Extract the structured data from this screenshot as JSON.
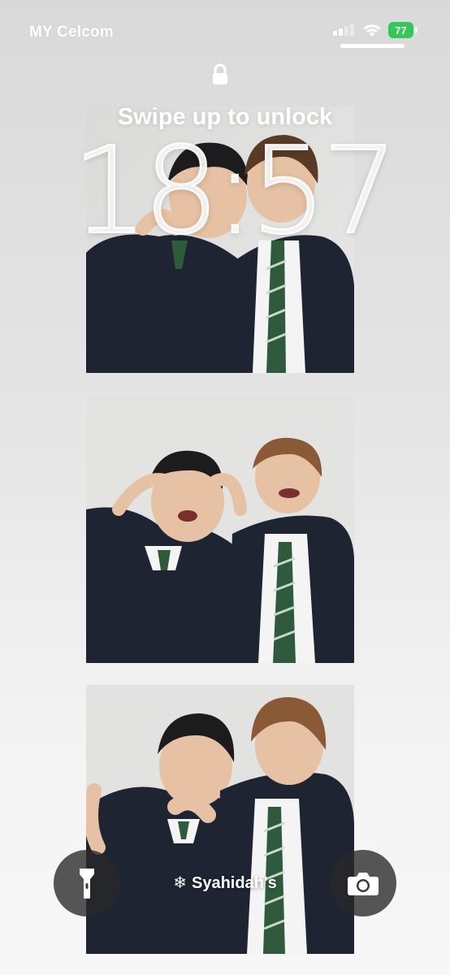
{
  "status_bar": {
    "carrier": "MY Celcom",
    "battery_level": "77",
    "signal_bars_active": 2,
    "signal_bars_total": 4,
    "icons": [
      "signal-icon",
      "wifi-icon",
      "battery-icon"
    ]
  },
  "lock_screen": {
    "swipe_hint": "Swipe up to unlock",
    "time": "18:57",
    "lock_icon": "lock-icon",
    "owner_label": "Syahidah's",
    "owner_icon": "snowflake-icon",
    "left_button_icon": "flashlight-icon",
    "right_button_icon": "camera-icon"
  },
  "wallpaper": {
    "photos": [
      "photo-strip-1",
      "photo-strip-2",
      "photo-strip-3"
    ],
    "colors": {
      "wall": "#e2e2e0",
      "blazer": "#1f2433",
      "tie_green": "#2f5a3c",
      "shirt": "#f4f4f4",
      "skin": "#e6c1a3",
      "hair_dark": "#1c1c1e",
      "hair_light": "#8a5a36"
    }
  }
}
